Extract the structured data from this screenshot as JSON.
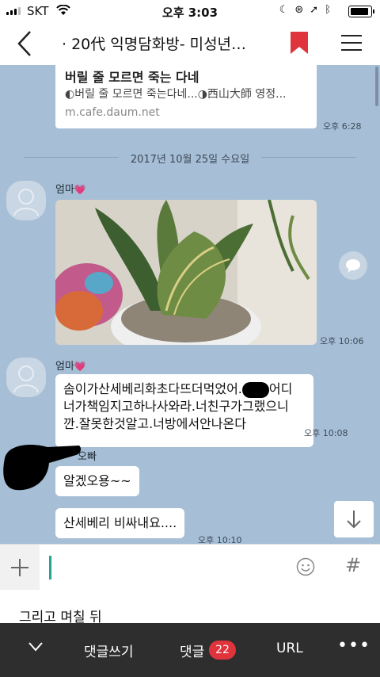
{
  "status_bar": {
    "carrier": "SKT",
    "time": "오후 3:03",
    "icons": [
      "signal-icon",
      "wifi-icon",
      "moon-icon",
      "rotation-lock-icon",
      "location-icon",
      "bluetooth-icon",
      "battery-icon"
    ]
  },
  "nav": {
    "title": "· 20代 익명담화방- 미성년…",
    "icons": [
      "back-icon",
      "bookmark-icon",
      "menu-icon"
    ],
    "bookmark_color": "#e0343c"
  },
  "chat": {
    "background": "#a6bed6",
    "link_card": {
      "title": "버릴 줄 모르면 죽는 다네",
      "description": "◐버릴 줄 모르면 죽는다네...◑西山大師 영정...",
      "domain": "m.cafe.daum.net",
      "time": "오후 6:28"
    },
    "date_divider": "2017년 10월 25일 수요일",
    "messages": [
      {
        "sender": "엄마",
        "type": "photo",
        "time": "오후 10:06"
      },
      {
        "sender": "엄마",
        "type": "text",
        "lines": [
          "솜이가산세베리화초다뜨더먹었어.",
          "어디",
          "너가책임지고하나사와라.너친구가그랬으니",
          "깐.잘못한것알고.너방에서안나온다"
        ],
        "time": "오후 10:08"
      },
      {
        "sender": "오빠",
        "type": "text",
        "lines": [
          "알겠오용~~"
        ]
      },
      {
        "sender": "오빠",
        "type": "text",
        "lines": [
          "산세베리 비싸내요...."
        ],
        "time": "오후 10:10"
      }
    ]
  },
  "input_bar": {
    "icons": [
      "plus-icon",
      "emoji-icon",
      "hash-icon"
    ],
    "caret_color": "#25a396"
  },
  "post_text": "그리고 며칠 뒤",
  "toolbar": {
    "write_comment": "댓글쓰기",
    "comments_label": "댓글",
    "comment_count": "22",
    "url": "URL",
    "more": "•••",
    "badge_color": "#e0343c"
  }
}
